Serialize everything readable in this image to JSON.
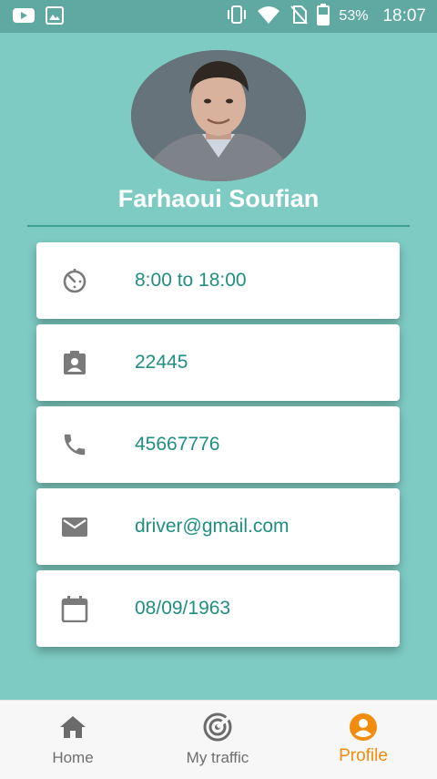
{
  "status_bar": {
    "battery_percent": "53%",
    "time": "18:07",
    "icons": [
      "youtube-icon",
      "image-icon",
      "vibrate-icon",
      "wifi-icon",
      "no-sim-icon",
      "battery-icon"
    ]
  },
  "profile": {
    "name": "Farhaoui Soufian"
  },
  "info_cards": [
    {
      "icon": "timer-icon",
      "value": "8:00 to 18:00"
    },
    {
      "icon": "badge-icon",
      "value": "22445"
    },
    {
      "icon": "phone-icon",
      "value": "45667776"
    },
    {
      "icon": "email-icon",
      "value": "driver@gmail.com"
    },
    {
      "icon": "calendar-icon",
      "value": "08/09/1963"
    }
  ],
  "bottom_nav": {
    "items": [
      {
        "label": "Home",
        "icon": "home-icon",
        "active": false
      },
      {
        "label": "My traffic",
        "icon": "radar-icon",
        "active": false
      },
      {
        "label": "Profile",
        "icon": "account-icon",
        "active": true
      }
    ]
  },
  "colors": {
    "background": "#7ecbc3",
    "status_bar": "#5fa9a2",
    "value_text": "#1f8f82",
    "active_nav": "#f28c0f"
  }
}
